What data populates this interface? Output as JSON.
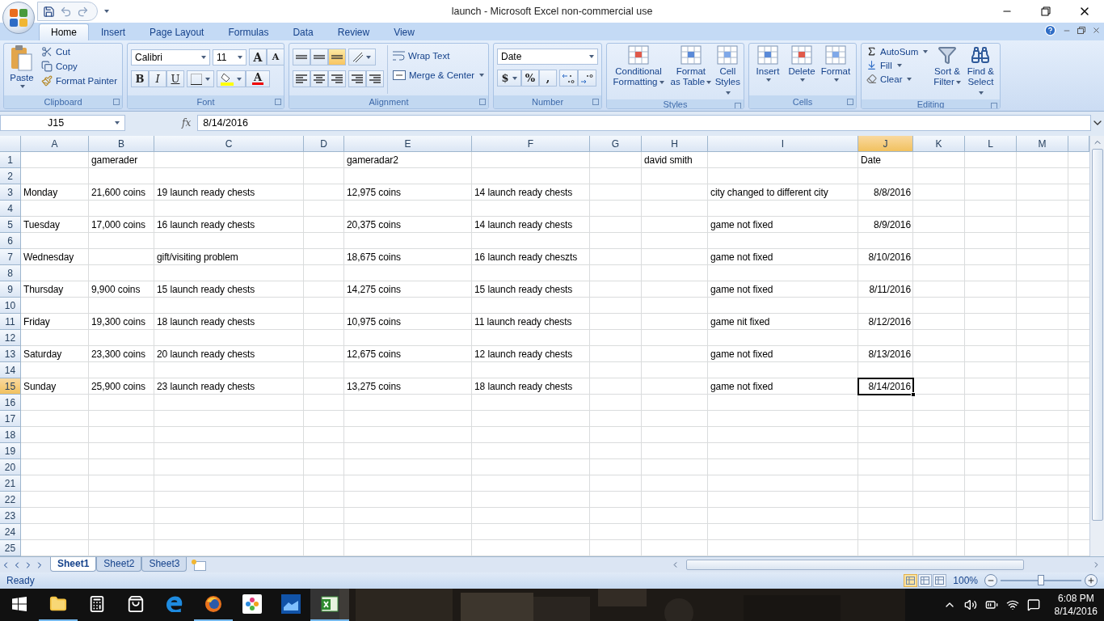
{
  "window": {
    "title": "launch - Microsoft Excel non-commercial use"
  },
  "ribbon_tabs": [
    {
      "label": "Home",
      "selected": true
    },
    {
      "label": "Insert",
      "selected": false
    },
    {
      "label": "Page Layout",
      "selected": false
    },
    {
      "label": "Formulas",
      "selected": false
    },
    {
      "label": "Data",
      "selected": false
    },
    {
      "label": "Review",
      "selected": false
    },
    {
      "label": "View",
      "selected": false
    }
  ],
  "clipboard": {
    "label": "Clipboard",
    "paste": "Paste",
    "cut": "Cut",
    "copy": "Copy",
    "format_painter": "Format Painter"
  },
  "font": {
    "label": "Font",
    "font_name": "Calibri",
    "font_size": "11",
    "grow": "A",
    "shrink": "A",
    "bold": "B",
    "italic": "I",
    "underline": "U",
    "font_color": "A"
  },
  "alignment": {
    "label": "Alignment",
    "vertical": [
      {
        "selected": false
      },
      {
        "selected": false
      },
      {
        "selected": true
      }
    ],
    "wrap_text": "Wrap Text",
    "merge_center": "Merge & Center"
  },
  "number": {
    "label": "Number",
    "format": "Date",
    "currency": "$",
    "percent": "%",
    "comma": ","
  },
  "styles": {
    "label": "Styles",
    "items": [
      "Conditional Formatting",
      "Format as Table",
      "Cell Styles"
    ]
  },
  "cells_group": {
    "label": "Cells",
    "items": [
      "Insert",
      "Delete",
      "Format"
    ]
  },
  "editing": {
    "label": "Editing",
    "autosum": "AutoSum",
    "fill": "Fill",
    "clear": "Clear",
    "sort_filter": "Sort & Filter",
    "find_select": "Find & Select"
  },
  "formula_bar": {
    "name_box": "J15",
    "fx": "fx",
    "formula": "8/14/2016"
  },
  "sheet": {
    "columns": [
      {
        "label": "A",
        "selected": false
      },
      {
        "label": "B",
        "selected": false
      },
      {
        "label": "C",
        "selected": false
      },
      {
        "label": "D",
        "selected": false
      },
      {
        "label": "E",
        "selected": false
      },
      {
        "label": "F",
        "selected": false
      },
      {
        "label": "G",
        "selected": false
      },
      {
        "label": "H",
        "selected": false
      },
      {
        "label": "I",
        "selected": false
      },
      {
        "label": "J",
        "selected": true
      },
      {
        "label": "K",
        "selected": false
      },
      {
        "label": "L",
        "selected": false
      },
      {
        "label": "M",
        "selected": false
      }
    ],
    "rows": [
      {
        "header": "1",
        "selected": false,
        "cells": [
          null,
          {
            "text": "gamerader",
            "kind": "text"
          },
          null,
          null,
          {
            "text": "gameradar2",
            "kind": "text"
          },
          null,
          null,
          {
            "text": "david smith",
            "kind": "text"
          },
          null,
          {
            "text": "Date",
            "kind": "text"
          },
          null,
          null,
          null
        ]
      },
      {
        "header": "2",
        "selected": false
      },
      {
        "header": "3",
        "selected": false,
        "cells": [
          {
            "text": "Monday",
            "kind": "text"
          },
          {
            "text": "21,600 coins",
            "kind": "text"
          },
          {
            "text": "19 launch ready chests",
            "kind": "text"
          },
          null,
          {
            "text": "12,975 coins",
            "kind": "text"
          },
          {
            "text": "14 launch ready chests",
            "kind": "text"
          },
          null,
          null,
          {
            "text": "city changed to different city",
            "kind": "text"
          },
          {
            "text": "8/8/2016",
            "kind": "date"
          },
          null,
          null,
          null
        ]
      },
      {
        "header": "4",
        "selected": false
      },
      {
        "header": "5",
        "selected": false,
        "cells": [
          {
            "text": "Tuesday",
            "kind": "text"
          },
          {
            "text": "17,000 coins",
            "kind": "text"
          },
          {
            "text": "16 launch ready chests",
            "kind": "text"
          },
          null,
          {
            "text": "20,375 coins",
            "kind": "text"
          },
          {
            "text": "14 launch ready chests",
            "kind": "text"
          },
          null,
          null,
          {
            "text": "game not fixed",
            "kind": "text"
          },
          {
            "text": "8/9/2016",
            "kind": "date"
          },
          null,
          null,
          null
        ]
      },
      {
        "header": "6",
        "selected": false
      },
      {
        "header": "7",
        "selected": false,
        "cells": [
          {
            "text": "Wednesday",
            "kind": "text"
          },
          null,
          {
            "text": "gift/visiting problem",
            "kind": "text"
          },
          null,
          {
            "text": "18,675 coins",
            "kind": "text"
          },
          {
            "text": "16 launch ready cheszts",
            "kind": "text"
          },
          null,
          null,
          {
            "text": "game not fixed",
            "kind": "text"
          },
          {
            "text": "8/10/2016",
            "kind": "date"
          },
          null,
          null,
          null
        ]
      },
      {
        "header": "8",
        "selected": false
      },
      {
        "header": "9",
        "selected": false,
        "cells": [
          {
            "text": "Thursday",
            "kind": "text"
          },
          {
            "text": "9,900 coins",
            "kind": "text"
          },
          {
            "text": "15 launch ready chests",
            "kind": "text"
          },
          null,
          {
            "text": "14,275 coins",
            "kind": "text"
          },
          {
            "text": "15 launch ready chests",
            "kind": "text"
          },
          null,
          null,
          {
            "text": "game not fixed",
            "kind": "text"
          },
          {
            "text": "8/11/2016",
            "kind": "date"
          },
          null,
          null,
          null
        ]
      },
      {
        "header": "10",
        "selected": false
      },
      {
        "header": "11",
        "selected": false,
        "cells": [
          {
            "text": "Friday",
            "kind": "text"
          },
          {
            "text": "19,300 coins",
            "kind": "text"
          },
          {
            "text": "18 launch ready chests",
            "kind": "text"
          },
          null,
          {
            "text": "10,975 coins",
            "kind": "text"
          },
          {
            "text": "11 launch ready chests",
            "kind": "text"
          },
          null,
          null,
          {
            "text": "game nit fixed",
            "kind": "text"
          },
          {
            "text": "8/12/2016",
            "kind": "date"
          },
          null,
          null,
          null
        ]
      },
      {
        "header": "12",
        "selected": false
      },
      {
        "header": "13",
        "selected": false,
        "cells": [
          {
            "text": "Saturday",
            "kind": "text"
          },
          {
            "text": "23,300 coins",
            "kind": "text"
          },
          {
            "text": "20 launch ready chests",
            "kind": "text"
          },
          null,
          {
            "text": "12,675 coins",
            "kind": "text"
          },
          {
            "text": "12 launch ready chests",
            "kind": "text"
          },
          null,
          null,
          {
            "text": "game not fixed",
            "kind": "text"
          },
          {
            "text": "8/13/2016",
            "kind": "date"
          },
          null,
          null,
          null
        ]
      },
      {
        "header": "14",
        "selected": false
      },
      {
        "header": "15",
        "selected": true,
        "cells": [
          {
            "text": "Sunday",
            "kind": "text"
          },
          {
            "text": "25,900 coins",
            "kind": "text"
          },
          {
            "text": "23 launch ready chests",
            "kind": "text"
          },
          null,
          {
            "text": "13,275 coins",
            "kind": "text"
          },
          {
            "text": "18 launch ready chests",
            "kind": "text"
          },
          null,
          null,
          {
            "text": "game not fixed",
            "kind": "text"
          },
          {
            "text": "8/14/2016",
            "kind": "date"
          },
          null,
          null,
          null
        ]
      },
      {
        "header": "16",
        "selected": false
      },
      {
        "header": "17",
        "selected": false
      },
      {
        "header": "18",
        "selected": false
      },
      {
        "header": "19",
        "selected": false
      },
      {
        "header": "20",
        "selected": false
      },
      {
        "header": "21",
        "selected": false
      },
      {
        "header": "22",
        "selected": false
      },
      {
        "header": "23",
        "selected": false
      },
      {
        "header": "24",
        "selected": false
      },
      {
        "header": "25",
        "selected": false
      }
    ]
  },
  "sheet_tabs": [
    {
      "label": "Sheet1",
      "selected": true
    },
    {
      "label": "Sheet2",
      "selected": false
    },
    {
      "label": "Sheet3",
      "selected": false
    }
  ],
  "status_bar": {
    "status": "Ready",
    "views": [
      {
        "selected": true
      },
      {
        "selected": false
      },
      {
        "selected": false
      }
    ],
    "zoom": "100%",
    "zoom_slider": {
      "level": 0.5
    }
  },
  "taskbar": {
    "apps": [
      {
        "kind": "folder",
        "running": true,
        "active": false
      },
      {
        "kind": "calculator",
        "running": false,
        "active": false
      },
      {
        "kind": "store",
        "running": false,
        "active": false
      },
      {
        "kind": "edge",
        "running": false,
        "active": false
      },
      {
        "kind": "firefox",
        "running": true,
        "active": false
      },
      {
        "kind": "photos",
        "running": false,
        "active": false
      },
      {
        "kind": "app",
        "running": false,
        "active": false
      },
      {
        "kind": "excel",
        "running": true,
        "active": true
      }
    ],
    "time": "6:08 PM",
    "date": "8/14/2016"
  }
}
